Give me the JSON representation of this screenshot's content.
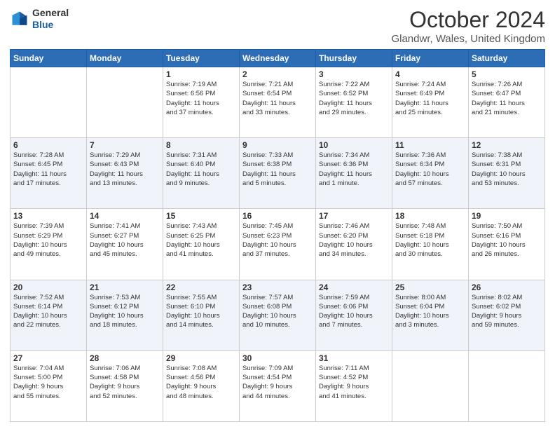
{
  "header": {
    "logo": {
      "line1": "General",
      "line2": "Blue"
    },
    "title": "October 2024",
    "location": "Glandwr, Wales, United Kingdom"
  },
  "weekdays": [
    "Sunday",
    "Monday",
    "Tuesday",
    "Wednesday",
    "Thursday",
    "Friday",
    "Saturday"
  ],
  "weeks": [
    [
      {
        "day": null,
        "info": ""
      },
      {
        "day": null,
        "info": ""
      },
      {
        "day": "1",
        "info": "Sunrise: 7:19 AM\nSunset: 6:56 PM\nDaylight: 11 hours\nand 37 minutes."
      },
      {
        "day": "2",
        "info": "Sunrise: 7:21 AM\nSunset: 6:54 PM\nDaylight: 11 hours\nand 33 minutes."
      },
      {
        "day": "3",
        "info": "Sunrise: 7:22 AM\nSunset: 6:52 PM\nDaylight: 11 hours\nand 29 minutes."
      },
      {
        "day": "4",
        "info": "Sunrise: 7:24 AM\nSunset: 6:49 PM\nDaylight: 11 hours\nand 25 minutes."
      },
      {
        "day": "5",
        "info": "Sunrise: 7:26 AM\nSunset: 6:47 PM\nDaylight: 11 hours\nand 21 minutes."
      }
    ],
    [
      {
        "day": "6",
        "info": "Sunrise: 7:28 AM\nSunset: 6:45 PM\nDaylight: 11 hours\nand 17 minutes."
      },
      {
        "day": "7",
        "info": "Sunrise: 7:29 AM\nSunset: 6:43 PM\nDaylight: 11 hours\nand 13 minutes."
      },
      {
        "day": "8",
        "info": "Sunrise: 7:31 AM\nSunset: 6:40 PM\nDaylight: 11 hours\nand 9 minutes."
      },
      {
        "day": "9",
        "info": "Sunrise: 7:33 AM\nSunset: 6:38 PM\nDaylight: 11 hours\nand 5 minutes."
      },
      {
        "day": "10",
        "info": "Sunrise: 7:34 AM\nSunset: 6:36 PM\nDaylight: 11 hours\nand 1 minute."
      },
      {
        "day": "11",
        "info": "Sunrise: 7:36 AM\nSunset: 6:34 PM\nDaylight: 10 hours\nand 57 minutes."
      },
      {
        "day": "12",
        "info": "Sunrise: 7:38 AM\nSunset: 6:31 PM\nDaylight: 10 hours\nand 53 minutes."
      }
    ],
    [
      {
        "day": "13",
        "info": "Sunrise: 7:39 AM\nSunset: 6:29 PM\nDaylight: 10 hours\nand 49 minutes."
      },
      {
        "day": "14",
        "info": "Sunrise: 7:41 AM\nSunset: 6:27 PM\nDaylight: 10 hours\nand 45 minutes."
      },
      {
        "day": "15",
        "info": "Sunrise: 7:43 AM\nSunset: 6:25 PM\nDaylight: 10 hours\nand 41 minutes."
      },
      {
        "day": "16",
        "info": "Sunrise: 7:45 AM\nSunset: 6:23 PM\nDaylight: 10 hours\nand 37 minutes."
      },
      {
        "day": "17",
        "info": "Sunrise: 7:46 AM\nSunset: 6:20 PM\nDaylight: 10 hours\nand 34 minutes."
      },
      {
        "day": "18",
        "info": "Sunrise: 7:48 AM\nSunset: 6:18 PM\nDaylight: 10 hours\nand 30 minutes."
      },
      {
        "day": "19",
        "info": "Sunrise: 7:50 AM\nSunset: 6:16 PM\nDaylight: 10 hours\nand 26 minutes."
      }
    ],
    [
      {
        "day": "20",
        "info": "Sunrise: 7:52 AM\nSunset: 6:14 PM\nDaylight: 10 hours\nand 22 minutes."
      },
      {
        "day": "21",
        "info": "Sunrise: 7:53 AM\nSunset: 6:12 PM\nDaylight: 10 hours\nand 18 minutes."
      },
      {
        "day": "22",
        "info": "Sunrise: 7:55 AM\nSunset: 6:10 PM\nDaylight: 10 hours\nand 14 minutes."
      },
      {
        "day": "23",
        "info": "Sunrise: 7:57 AM\nSunset: 6:08 PM\nDaylight: 10 hours\nand 10 minutes."
      },
      {
        "day": "24",
        "info": "Sunrise: 7:59 AM\nSunset: 6:06 PM\nDaylight: 10 hours\nand 7 minutes."
      },
      {
        "day": "25",
        "info": "Sunrise: 8:00 AM\nSunset: 6:04 PM\nDaylight: 10 hours\nand 3 minutes."
      },
      {
        "day": "26",
        "info": "Sunrise: 8:02 AM\nSunset: 6:02 PM\nDaylight: 9 hours\nand 59 minutes."
      }
    ],
    [
      {
        "day": "27",
        "info": "Sunrise: 7:04 AM\nSunset: 5:00 PM\nDaylight: 9 hours\nand 55 minutes."
      },
      {
        "day": "28",
        "info": "Sunrise: 7:06 AM\nSunset: 4:58 PM\nDaylight: 9 hours\nand 52 minutes."
      },
      {
        "day": "29",
        "info": "Sunrise: 7:08 AM\nSunset: 4:56 PM\nDaylight: 9 hours\nand 48 minutes."
      },
      {
        "day": "30",
        "info": "Sunrise: 7:09 AM\nSunset: 4:54 PM\nDaylight: 9 hours\nand 44 minutes."
      },
      {
        "day": "31",
        "info": "Sunrise: 7:11 AM\nSunset: 4:52 PM\nDaylight: 9 hours\nand 41 minutes."
      },
      {
        "day": null,
        "info": ""
      },
      {
        "day": null,
        "info": ""
      }
    ]
  ]
}
